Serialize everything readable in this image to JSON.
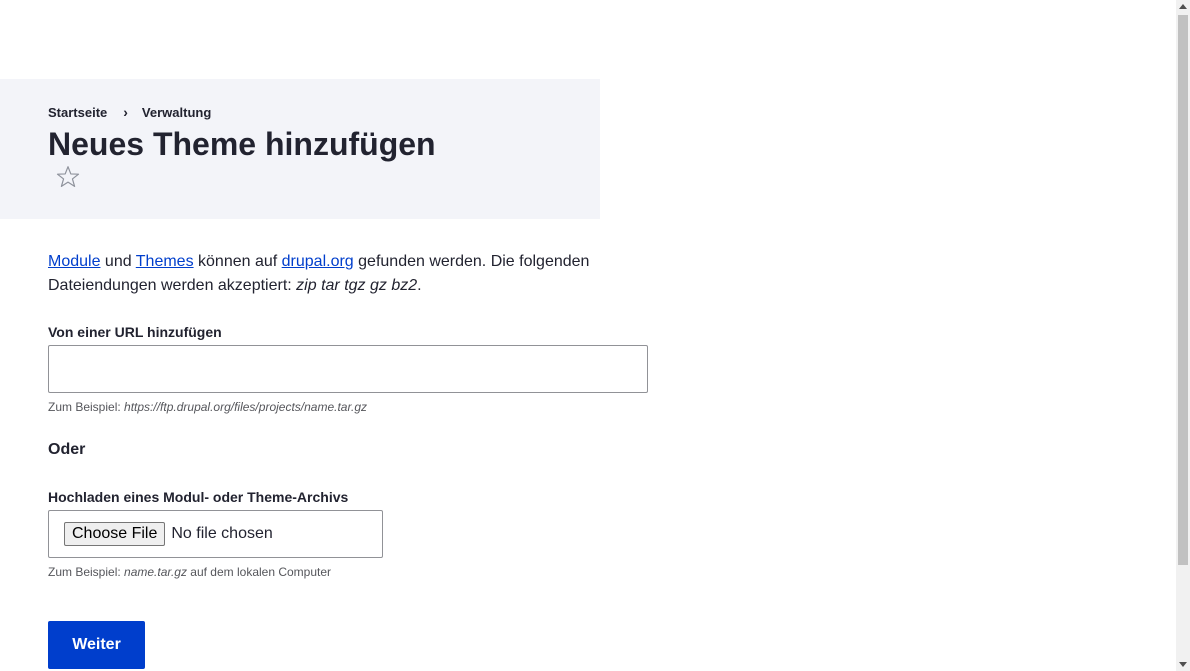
{
  "breadcrumb": {
    "items": [
      {
        "label": "Startseite"
      },
      {
        "label": "Verwaltung"
      }
    ],
    "separator": "›"
  },
  "header": {
    "title": "Neues Theme hinzufügen",
    "star_icon": "star-outline-icon",
    "background_color": "#f3f4f9"
  },
  "intro": {
    "link_modules": "Module",
    "text_and": " und ",
    "link_themes": "Themes",
    "text_can": " können auf ",
    "link_drupal": "drupal.org",
    "text_found": " gefunden werden. Die folgenden Dateiendungen werden akzeptiert: ",
    "extensions": "zip tar tgz gz bz2",
    "period": "."
  },
  "url_field": {
    "label": "Von einer URL hinzufügen",
    "value": "",
    "description_prefix": "Zum Beispiel: ",
    "description_example": "https://ftp.drupal.org/files/projects/name.tar.gz"
  },
  "or_heading": "Oder",
  "upload_field": {
    "label": "Hochladen eines Modul- oder Theme-Archivs",
    "button_label": "Choose File",
    "status": "No file chosen",
    "description_prefix": "Zum Beispiel: ",
    "description_example": "name.tar.gz",
    "description_suffix": " auf dem lokalen Computer"
  },
  "submit": {
    "label": "Weiter",
    "color": "#003ecc"
  },
  "colors": {
    "link": "#003ecc",
    "text": "#222330"
  }
}
